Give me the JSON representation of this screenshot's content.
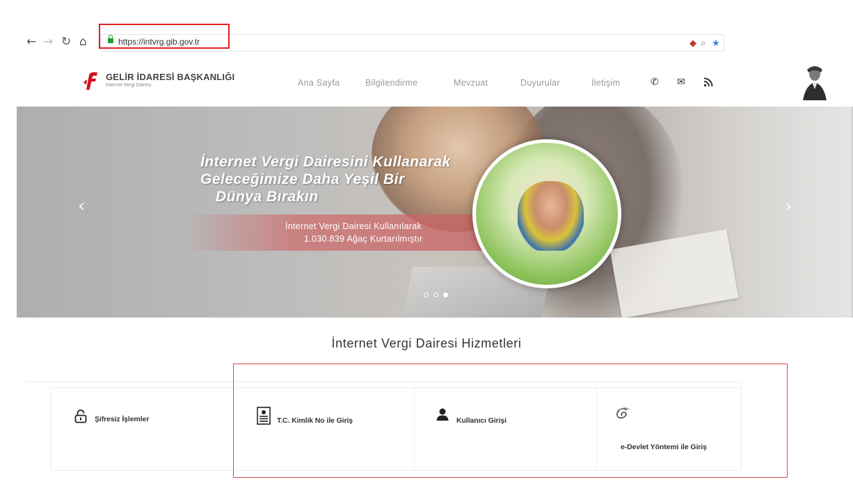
{
  "browser": {
    "url": "https://intvrg.gib.gov.tr"
  },
  "header": {
    "brand": "GELİR İDARESİ BAŞKANLIĞI",
    "brand_sub": "İnternet Vergi Dairesi",
    "nav": [
      "Ana Sayfa",
      "Bilgilendirme",
      "Mevzuat",
      "Duyurular",
      "İletişim"
    ]
  },
  "hero": {
    "title_lines": [
      "İnternet Vergi Dairesini Kullanarak",
      "Geleceğimize Daha Yeşil Bir",
      "Dünya Bırakın"
    ],
    "ribbon_lines": [
      "İnternet Vergi Dairesi Kullanılarak",
      "1.030.839 Ağaç Kurtarılmıştır"
    ],
    "slides": 3,
    "active_slide": 3
  },
  "services": {
    "title": "İnternet Vergi Dairesi Hizmetleri",
    "items": [
      {
        "label": "Şifresiz İşlemler",
        "icon": "unlock-icon"
      },
      {
        "label": "T.C. Kimlik No ile Giriş",
        "icon": "id-card-icon"
      },
      {
        "label": "Kullanıcı Girişi",
        "icon": "user-icon"
      },
      {
        "label": "e-Devlet Yöntemi ile Giriş",
        "icon": "edevlet-icon"
      }
    ]
  },
  "colors": {
    "highlight": "#e02020",
    "brand_red": "#d0121b",
    "secure_green": "#1f9d38"
  }
}
